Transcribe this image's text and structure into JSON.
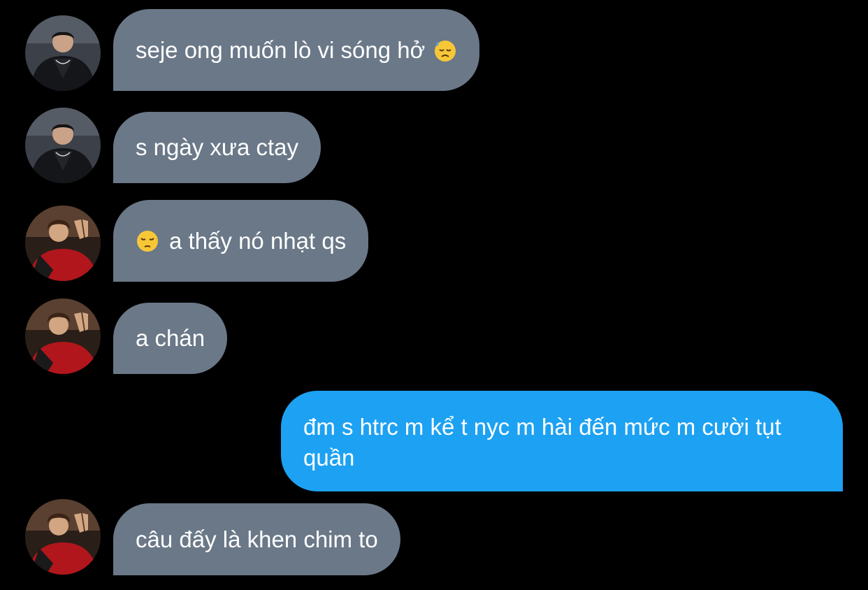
{
  "messages": [
    {
      "direction": "incoming",
      "sender": "friend-1",
      "text": "seje ong muốn lò vi sóng hở",
      "emoji": "downcast-face-with-sweat-icon",
      "emoji_position": "end"
    },
    {
      "direction": "incoming",
      "sender": "friend-1",
      "text": "s ngày xưa ctay"
    },
    {
      "direction": "incoming",
      "sender": "friend-2",
      "text": "a thấy nó nhạt qs",
      "emoji": "pensive-face-icon",
      "emoji_position": "start"
    },
    {
      "direction": "incoming",
      "sender": "friend-2",
      "text": "a chán"
    },
    {
      "direction": "outgoing",
      "sender": "me",
      "text": "đm s htrc m kể t nyc m hài đến mức m cười tụt quần"
    },
    {
      "direction": "incoming",
      "sender": "friend-2",
      "text": "câu đấy là khen chim to"
    }
  ],
  "colors": {
    "background": "#000000",
    "incoming_bubble": "#6a7888",
    "outgoing_bubble": "#1da1f2",
    "text": "#ffffff"
  }
}
